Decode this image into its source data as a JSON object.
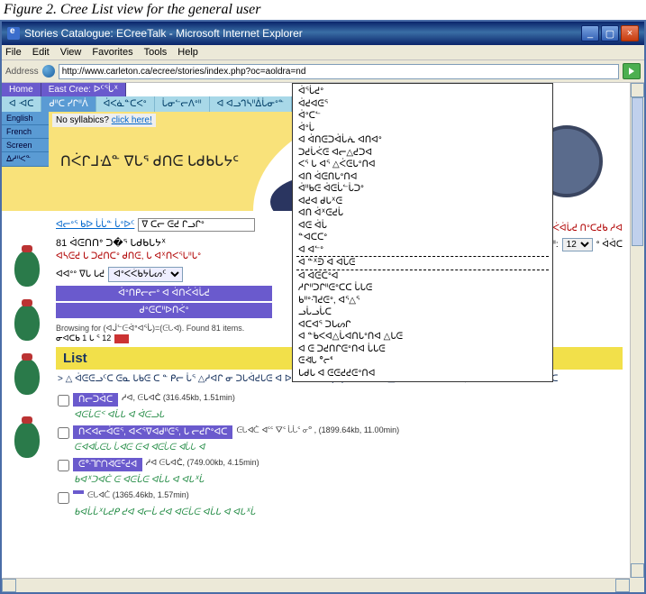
{
  "caption": "Figure 2. Cree List view for the general user",
  "window": {
    "title": "Stories Catalogue: ECreeTalk - Microsoft Internet Explorer",
    "menus": [
      "File",
      "Edit",
      "View",
      "Favorites",
      "Tools",
      "Help"
    ],
    "address_label": "Address",
    "address_url": "http://www.carleton.ca/ecree/stories/index.php?oc=aoldra=nd"
  },
  "breadcrumb": {
    "home": "Home",
    "section": "East Cree: ᐅᑦᕐᒑᕽ"
  },
  "tabs": [
    "ᐊ ᐗᑕ",
    "ᑯᐦᑕ ᓯᒋᐦᐲ",
    "ᐋᐸᓈᓐᑕᐸᐤ",
    "ᒑᓂᓪᓕᐱᐤᐦ",
    "ᐊ ᐊᓗᒉᓴᐦᐄᒑᓂᐤᓐ"
  ],
  "sidebar_buttons": [
    "English",
    "French",
    "Screen",
    "ᐃᓱᐦᐸᓐ"
  ],
  "syllabics_prompt": {
    "text": "No syllabics?",
    "link": "click here!"
  },
  "banner_title": "ᑎᐹᒋᒧᐎᓐ ᐁᒐᕐ ᑯᑎᕮ ᒐᑯᑲᒐᔭᑦ",
  "search": {
    "link_label": "ᐊᓕᐤᕐ ᑲᐅ ᒑᒑᓐ ᒑᐤᐅᑦ",
    "input_value": "ᐁ ᑕᓕ ᕮᕍ ᒋᓗᒋᐤ"
  },
  "results_header": "81 ᐋᕮᑎᑎᐤ ᑐ�ᕐ ᒐᑯᑲᒐᔭᕽ",
  "red_line_left": "ᐊᓴᕮᕍ ᒐ ᑐᕍᑎᑖᐤ ᑯᑎᕮ, ᒐ ᐊᕽᑎᐸᕐᒑᐦᒑᐤ",
  "sort": {
    "prefix": "ᐊᐊᐤᐤ ᐁᒐ ᒐᕍ",
    "select_value": "ᐊᐤᐸᐹᑲᔭᒑᔕᑦ"
  },
  "action_buttons": [
    "ᐋᐤᑎᑭᓕᓕᐤ ᐊ ᐋᑎᐹᐋᒑᕍ",
    "ᑯᐤᕮᑕᐦᐅᑎᐹᐤ"
  ],
  "browsing_text": "Browsing for (ᐊᒎᓪᕮᐋᐤᐊᕐᒑ)=(ᕮᒐᐊ). Found 81 items.",
  "pager_text": "ᓂᐊᑕᑲ 1 ᒐ ᕐ 12",
  "list_header": "List",
  "summary": "> △ ᐋᕮᕮᓗᑦᑕ ᕮᓇ ᒐᑲᕮ ᑕ ᓐ ᑭᓕ ᒑᕐ △ᓱᐊᒋ ᓂ\nᑐᒐᐋᕍᒐᕮ ᐊ ᐅᕽᒑᐤ ᐊᕽᒑᐤ (☑)\n> ᐊᑎᓕ ᐊ △ ᕮᐸᕽᐤᓚ ᑎᐹᒋᒧᐎᐤ, ᐁᒐ ᐊ ᑌᐤᐅᐹᓕᒋ\nᒑᕮᐋᑕ",
  "items": [
    {
      "title": "ᑎᓕᑐᐋᑕ",
      "meta": "ᓱᐊ, ᕮᒐᐊᑖ (316.45kb, 1.51min)",
      "desc": "ᐊᕮᒑᕮᑉ ᐊᒑᒐ ᐊ ᐋᕮᓗᒐ"
    },
    {
      "title": "ᑎᐸᐊᓕᐋᕮᕐ, ᐊᐸᕐᐁᐊᑯᐦᕮᕐ, ᒐ ᓕᕍᒋᐤᐊᑕ",
      "meta": "ᕮᒐᐊᑖ ᐊᕐᕐ ᐁᕐ ᒑᒑᕐ ᓂᐤ  , (1899.64kb, 11.00min)",
      "desc": "ᕮᐊᐊᒑᕮᒐ ᒑᐊᕮ ᕮᐊ ᐊᕮᒑᕮ ᐊᒑᒐ ᐊ"
    },
    {
      "title": "ᕮᐤᒬᒋᑎᐋᕮᑦᕍᐊ",
      "meta": "ᓱᐊ ᕮᒐᐊᑖ, (749.00kb, 4.15min)",
      "desc": "ᑲᐊᕽᑐᐊᑖ ᕮ ᐊᕮᒑᕮ ᐊᒑᒐ ᐊ ᐊᒐᕽᒑ"
    },
    {
      "title": "",
      "meta": "ᕮᒐᐊᑖ (1365.46kb, 1.57min)",
      "desc": "ᑲᐊᒑᒑᕽᒐᕍᑭ ᕍᐊ ᐊᓕᒑ ᕍᐊ ᐊᕮᒑᕮ ᐊᒑᒐ ᐊ ᐊᒐᕽᒑ"
    }
  ],
  "right_red": "ᐊ ᐋᑎᐹᐋᒑᕍ ᑎᐤᑕᕍᑲ   ᓱᐊ",
  "per_page": {
    "prefix": "(ᒑᑐᐤ ᕮᓗᐦ:",
    "value": "12",
    "suffix": "ᐤ ᐋᐋᑕ"
  },
  "dropdown_options": [
    "ᐋᕐᒑᕍᐤ",
    "ᐋᕍᐊᕮᕐ",
    "ᐋᐤᑕᓪ",
    "ᐋᐤᒑ",
    "ᐊ ᐋᑎᕮᑐᐋᒑᕇ ᐊᑎᐊᐤ",
    "ᑐᕍᒑᐹᕮ ᐊᓕ△ᕍᑐᐊ",
    "ᐸᕐ ᒐ ᐊᕐ △ᐹᕮᒐᐤᑎᐊ",
    "ᐊᑎ ᐋᕮᑎᒐᐤᑎᐊ",
    "ᐋᐦᑲᕮ ᐋᕮᒑᓪᒑᑐᐤ",
    "ᐊᕍᐊ ᑯᒐᕽᕮ",
    "ᐊᑎ ᐋᕽᕮᕍᒑ",
    "ᐊᕮ ᐋᒑ",
    "ᓐᐊᑕᑕᐤ",
    "ᐊ ᐊᓪᐤ",
    "ᐊ ᓐᕽᕭ ᐊ ᐊᒑᕮ",
    "ᐊ ᐊᕮᑕᐤᐊ",
    "ᓱᒋᐦᑐᒋᐦᕮᐤᑕᑕ ᒑᒐᕮ",
    "ᑲᐦᐤᒬᕍᕮᐤ, ᐊᕐ△ᕐ",
    "ᓗᒑᓗᒑᑕ",
    "ᐊᑕᐊᕐ ᑐᒐᔕᒋ",
    "ᐊ ᓐᑲᐸᐊ△ᒑᐊᑎᒐᐤᑎᐊ △ᒐᕮ",
    "ᐊ ᕮ ᑐᕍᑎᒋᕮᐤᑎᐊ ᒑᒐᕮ",
    "ᕮᐋᒐ ᐤᓕᕐ",
    "ᒐᑯᒐ ᐊ ᕮᕮᕍᕍᕮᐤᑎᐊ"
  ],
  "dropdown_selected_index": 14
}
